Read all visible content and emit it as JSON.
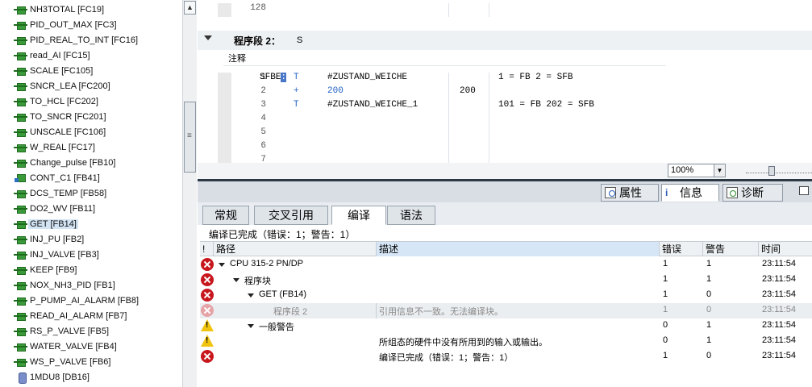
{
  "tree": {
    "items": [
      {
        "label": "NH3TOTAL [FC19]",
        "icon": "fc-block-icon"
      },
      {
        "label": "PID_OUT_MAX [FC3]",
        "icon": "fc-block-icon"
      },
      {
        "label": "PID_REAL_TO_INT [FC16]",
        "icon": "fc-block-icon"
      },
      {
        "label": "read_AI [FC15]",
        "icon": "fc-block-icon"
      },
      {
        "label": "SCALE [FC105]",
        "icon": "fc-block-icon"
      },
      {
        "label": "SNCR_LEA [FC200]",
        "icon": "fc-block-icon"
      },
      {
        "label": "TO_HCL [FC202]",
        "icon": "fc-block-icon"
      },
      {
        "label": "TO_SNCR [FC201]",
        "icon": "fc-block-icon"
      },
      {
        "label": "UNSCALE [FC106]",
        "icon": "fc-block-icon"
      },
      {
        "label": "W_REAL [FC17]",
        "icon": "fc-block-icon"
      },
      {
        "label": "Change_pulse [FB10]",
        "icon": "fb-block-icon"
      },
      {
        "label": "CONT_C1 [FB41]",
        "icon": "fb-multi-icon"
      },
      {
        "label": "DCS_TEMP [FB58]",
        "icon": "fb-block-icon"
      },
      {
        "label": "DO2_WV [FB11]",
        "icon": "fb-block-icon"
      },
      {
        "label": "GET [FB14]",
        "icon": "fb-block-icon",
        "selected": true
      },
      {
        "label": "INJ_PU [FB2]",
        "icon": "fb-block-icon"
      },
      {
        "label": "INJ_VALVE [FB3]",
        "icon": "fb-block-icon"
      },
      {
        "label": "KEEP [FB9]",
        "icon": "fb-block-icon"
      },
      {
        "label": "NOX_NH3_PID [FB1]",
        "icon": "fb-block-icon"
      },
      {
        "label": "P_PUMP_AI_ALARM [FB8]",
        "icon": "fb-block-icon"
      },
      {
        "label": "READ_AI_ALARM [FB7]",
        "icon": "fb-block-icon"
      },
      {
        "label": "RS_P_VALVE [FB5]",
        "icon": "fb-block-icon"
      },
      {
        "label": "WATER_VALVE [FB4]",
        "icon": "fb-block-icon"
      },
      {
        "label": "WS_P_VALVE [FB6]",
        "icon": "fb-block-icon"
      },
      {
        "label": "1MDU8 [DB16]",
        "icon": "db-block-icon"
      }
    ]
  },
  "editor": {
    "top_line_no": "128",
    "network_title": "程序段 2：",
    "network_subtitle": "S",
    "comment_label": "注释",
    "lines": [
      {
        "no": "1",
        "label": "SFBE",
        "op": "T",
        "operand": "#ZUSTAND_WEICHE",
        "value": "",
        "comment": "1 = FB  2 = SFB"
      },
      {
        "no": "2",
        "label": "",
        "op": "+",
        "operand": "200",
        "value": "200",
        "comment": ""
      },
      {
        "no": "3",
        "label": "",
        "op": "T",
        "operand": "#ZUSTAND_WEICHE_1",
        "value": "",
        "comment": "101 = FB  202 = SFB"
      },
      {
        "no": "4",
        "label": "",
        "op": "",
        "operand": "",
        "value": "",
        "comment": ""
      },
      {
        "no": "5",
        "label": "",
        "op": "",
        "operand": "",
        "value": "",
        "comment": ""
      },
      {
        "no": "6",
        "label": "",
        "op": "",
        "operand": "",
        "value": "",
        "comment": ""
      },
      {
        "no": "7",
        "label": "",
        "op": "",
        "operand": "",
        "value": "",
        "comment": ""
      }
    ],
    "zoom": "100%"
  },
  "inspector": {
    "tabs": {
      "properties": "属性",
      "info": "信息",
      "diagnostics": "诊断"
    },
    "sub_tabs": [
      "常规",
      "交叉引用",
      "编译",
      "语法"
    ],
    "active_sub_tab": "编译",
    "status": "编译已完成（错误：1；警告：1）",
    "columns": {
      "flag": "!",
      "path": "路径",
      "description": "描述",
      "errors": "错误",
      "warnings": "警告",
      "time": "时间"
    },
    "messages": [
      {
        "type": "error",
        "indent": 0,
        "expander": true,
        "path": "CPU 315-2 PN/DP",
        "description": "",
        "errors": "1",
        "warnings": "1",
        "time": "23:11:54"
      },
      {
        "type": "error",
        "indent": 1,
        "expander": true,
        "path": "程序块",
        "description": "",
        "errors": "1",
        "warnings": "1",
        "time": "23:11:54"
      },
      {
        "type": "error",
        "indent": 2,
        "expander": true,
        "path": "GET (FB14)",
        "description": "",
        "errors": "1",
        "warnings": "0",
        "time": "23:11:54"
      },
      {
        "type": "error-faded",
        "indent": 3,
        "expander": false,
        "path": "程序段 2",
        "description": "引用信息不一致。无法编译块。",
        "errors": "1",
        "warnings": "0",
        "time": "23:11:54"
      },
      {
        "type": "warning",
        "indent": 2,
        "expander": true,
        "path": "一般警告",
        "description": "",
        "errors": "0",
        "warnings": "1",
        "time": "23:11:54"
      },
      {
        "type": "warning",
        "indent": 0,
        "expander": false,
        "path": "",
        "description": "所组态的硬件中没有所用到的输入或输出。",
        "errors": "0",
        "warnings": "1",
        "time": "23:11:54"
      },
      {
        "type": "error",
        "indent": 0,
        "expander": false,
        "path": "",
        "description": "编译已完成（错误：1；警告：1）",
        "errors": "1",
        "warnings": "0",
        "time": "23:11:54"
      }
    ]
  }
}
